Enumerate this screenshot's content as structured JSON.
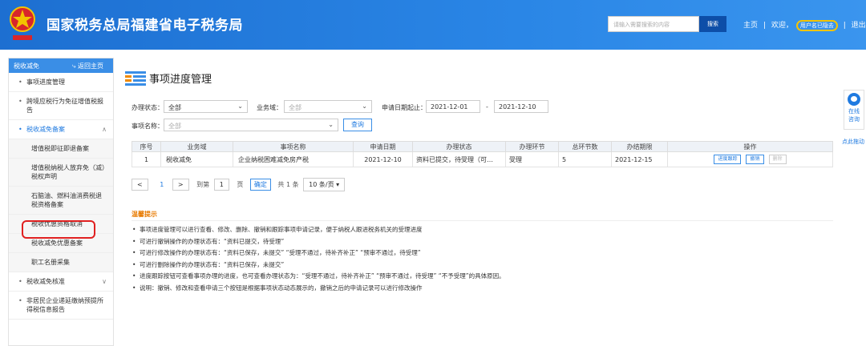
{
  "header": {
    "title": "国家税务总局福建省电子税务局",
    "search_placeholder": "请输入需要搜索的内容",
    "search_button": "搜索",
    "links": [
      "主页",
      "欢迎，",
      "退出"
    ],
    "user_name": "用户名已隐去"
  },
  "sidebar": {
    "head_label": "税收减免",
    "back_label": "返回主页",
    "items": [
      {
        "label": "事项进度管理"
      },
      {
        "label": "跨境应税行为免征增值税报告"
      },
      {
        "label": "税收减免备案",
        "expanded": true
      },
      {
        "label": "税收减免核准"
      },
      {
        "label": "非居民企业递延缴纳预提所得税信息报告"
      }
    ],
    "subitems": [
      "增值税即征即退备案",
      "增值税纳税人放弃免（减）税权声明",
      "石脑油、燃料油消费税退税资格备案",
      "税收优惠资格取消",
      "税收减免优惠备案",
      "职工名册采集"
    ]
  },
  "main": {
    "page_title": "事项进度管理",
    "filters": {
      "status_label": "办理状态：",
      "status_value": "全部",
      "business_label": "业务域：",
      "business_value": "全部",
      "date_label": "申请日期起止：",
      "date_start": "2021-12-01",
      "date_sep": "-",
      "date_end": "2021-12-10",
      "item_label": "事项名称：",
      "item_value": "全部",
      "query_button": "查询"
    },
    "table": {
      "headers": [
        "序号",
        "业务域",
        "事项名称",
        "申请日期",
        "办理状态",
        "办理环节",
        "总环节数",
        "办结期限",
        "操作"
      ],
      "rows": [
        [
          "1",
          "税收减免",
          "企业纳税困难减免房产税",
          "2021-12-10",
          "资料已提交，待受理（可…",
          "受理",
          "5",
          "2021-12-15"
        ]
      ],
      "ops": [
        "进度跟踪",
        "撤销",
        "删除"
      ]
    },
    "pager": {
      "prev": "<",
      "current": "1",
      "next": ">",
      "goto_label": "到第",
      "goto_value": "1",
      "page_label": "页",
      "confirm": "确定",
      "total": "共 1 条",
      "page_size": "10 条/页"
    },
    "tips_title": "温馨提示",
    "tips": [
      "事项进度管理可以进行查看、修改、删除、撤销和跟踪事项申请记录，便于纳税人跟进税务机关的受理进度",
      "可进行撤销操作的办理状态有：“资料已提交，待受理”",
      "可进行修改操作的办理状态有：“资料已保存，未提交” “受理不通过，待补齐补正” “预审不通过，待受理”",
      "可进行删除操作的办理状态有：“资料已保存，未提交”",
      "进度跟踪按钮可查看事项办理的进度，也可查看办理状态为：“受理不通过，待补齐补正” “预审不通过，待受理” “不予受理”的具体原因。",
      "说明：撤销、修改和查看申请三个按钮是根据事项状态动态展示的，撤销之后的申请记录可以进行修改操作"
    ]
  },
  "float": {
    "help_label_1": "在线",
    "help_label_2": "咨询",
    "side_label": "点此拖动"
  },
  "colors": {
    "header_blue": "#2a86e6",
    "accent": "#1f7ae0",
    "highlight_red": "#e02020",
    "tips_orange": "#e87a00"
  }
}
